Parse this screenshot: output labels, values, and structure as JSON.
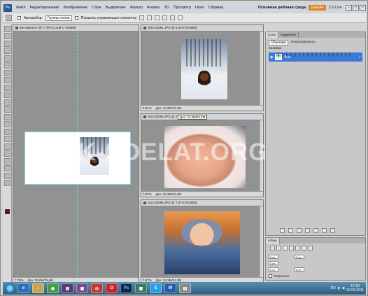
{
  "menu": {
    "logo": "Ps",
    "items": [
      "Файл",
      "Редактирование",
      "Изображение",
      "Слои",
      "Выделение",
      "Фильтр",
      "Анализ",
      "3D",
      "Просмотр",
      "Окно",
      "Справка"
    ],
    "zoom": "63,1",
    "workspace": "Основная рабочая среда",
    "design_button": "Дизайн",
    "cs_live": "CS Live"
  },
  "options": {
    "autoselect_label": "Автовыбор:",
    "autoselect_value": "Группы слоев",
    "show_controls_label": "Показать управляющие элементы"
  },
  "left_doc": {
    "tab": "Без имени-1 @ 7,78% (Слой 1, RGB/8)",
    "zoom": "7,78%",
    "doc_info": "Док: 35,6M/76,6M"
  },
  "doc1": {
    "tab": "DSCN1081.JPG @ 5,31% (RGB/8)",
    "zoom": "5,31%",
    "doc_info": "Док: 34,3M/34,3M"
  },
  "doc2": {
    "tab": "DSCN1093.JPG @ 7,07% (RGB/8)",
    "zoom": "7,07%",
    "doc_info": "Док: 34,3M/34,3M",
    "tooltip": "Док: 34,3M/34,3M"
  },
  "doc3": {
    "tab": "DSCN1096.JPG @ 7,07% (RGB/8)",
    "zoom": "7,07%",
    "doc_info": "Док: 34,3M/34,3M"
  },
  "watermark": "KAK-SDELAT.ORG",
  "layers_panel": {
    "tabs": [
      "Слои",
      "Коррекция"
    ],
    "blend_mode": "Обычные",
    "opacity_label": "Непрозрачность:",
    "fill_label": "Заливка:",
    "layer_name": "Фон"
  },
  "paragraph_panel": {
    "tab": "Абзац",
    "fields": [
      "0 пт",
      "0 пт",
      "0 пт",
      "0 пт",
      "0 пт"
    ],
    "hyphenation": "Переносы"
  },
  "taskbar": {
    "lang": "RU",
    "time": "17:20",
    "date": "02.09.2011",
    "apps": [
      "e",
      "⌂",
      "◉",
      "▤",
      "▣",
      "◎",
      "O",
      "Ps",
      "▦",
      "S",
      "W",
      "▤"
    ]
  },
  "colors": {
    "accent": "#3b7ad8",
    "design_button": "#e08020",
    "foreground_swatch": "#7a0a0a"
  }
}
